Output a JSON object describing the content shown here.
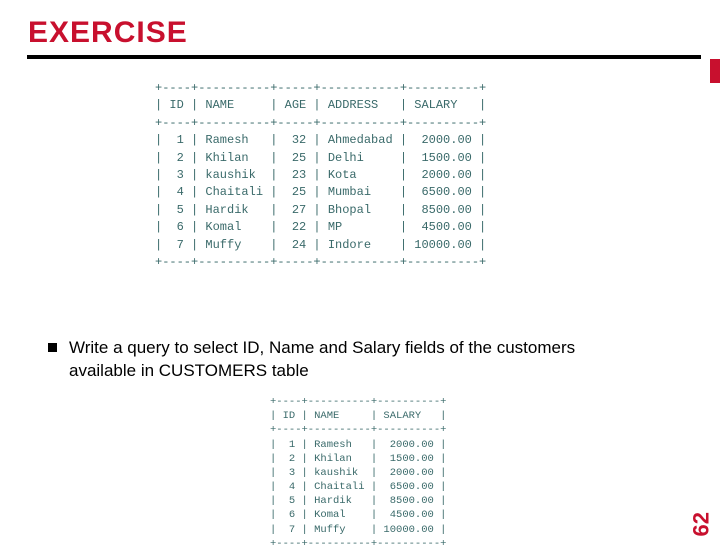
{
  "title": "EXERCISE",
  "bullet": {
    "line1": "Write a query to select ID, Name and Salary fields of the customers",
    "line2": "available in CUSTOMERS table"
  },
  "page_number": "62",
  "table_full": {
    "columns": [
      "ID",
      "NAME",
      "AGE",
      "ADDRESS",
      "SALARY"
    ],
    "rows": [
      {
        "id": "1",
        "name": "Ramesh",
        "age": "32",
        "address": "Ahmedabad",
        "salary": "2000.00"
      },
      {
        "id": "2",
        "name": "Khilan",
        "age": "25",
        "address": "Delhi",
        "salary": "1500.00"
      },
      {
        "id": "3",
        "name": "kaushik",
        "age": "23",
        "address": "Kota",
        "salary": "2000.00"
      },
      {
        "id": "4",
        "name": "Chaitali",
        "age": "25",
        "address": "Mumbai",
        "salary": "6500.00"
      },
      {
        "id": "5",
        "name": "Hardik",
        "age": "27",
        "address": "Bhopal",
        "salary": "8500.00"
      },
      {
        "id": "6",
        "name": "Komal",
        "age": "22",
        "address": "MP",
        "salary": "4500.00"
      },
      {
        "id": "7",
        "name": "Muffy",
        "age": "24",
        "address": "Indore",
        "salary": "10000.00"
      }
    ]
  },
  "table_result": {
    "columns": [
      "ID",
      "NAME",
      "SALARY"
    ],
    "rows": [
      {
        "id": "1",
        "name": "Ramesh",
        "salary": "2000.00"
      },
      {
        "id": "2",
        "name": "Khilan",
        "salary": "1500.00"
      },
      {
        "id": "3",
        "name": "kaushik",
        "salary": "2000.00"
      },
      {
        "id": "4",
        "name": "Chaitali",
        "salary": "6500.00"
      },
      {
        "id": "5",
        "name": "Hardik",
        "salary": "8500.00"
      },
      {
        "id": "6",
        "name": "Komal",
        "salary": "4500.00"
      },
      {
        "id": "7",
        "name": "Muffy",
        "salary": "10000.00"
      }
    ]
  }
}
